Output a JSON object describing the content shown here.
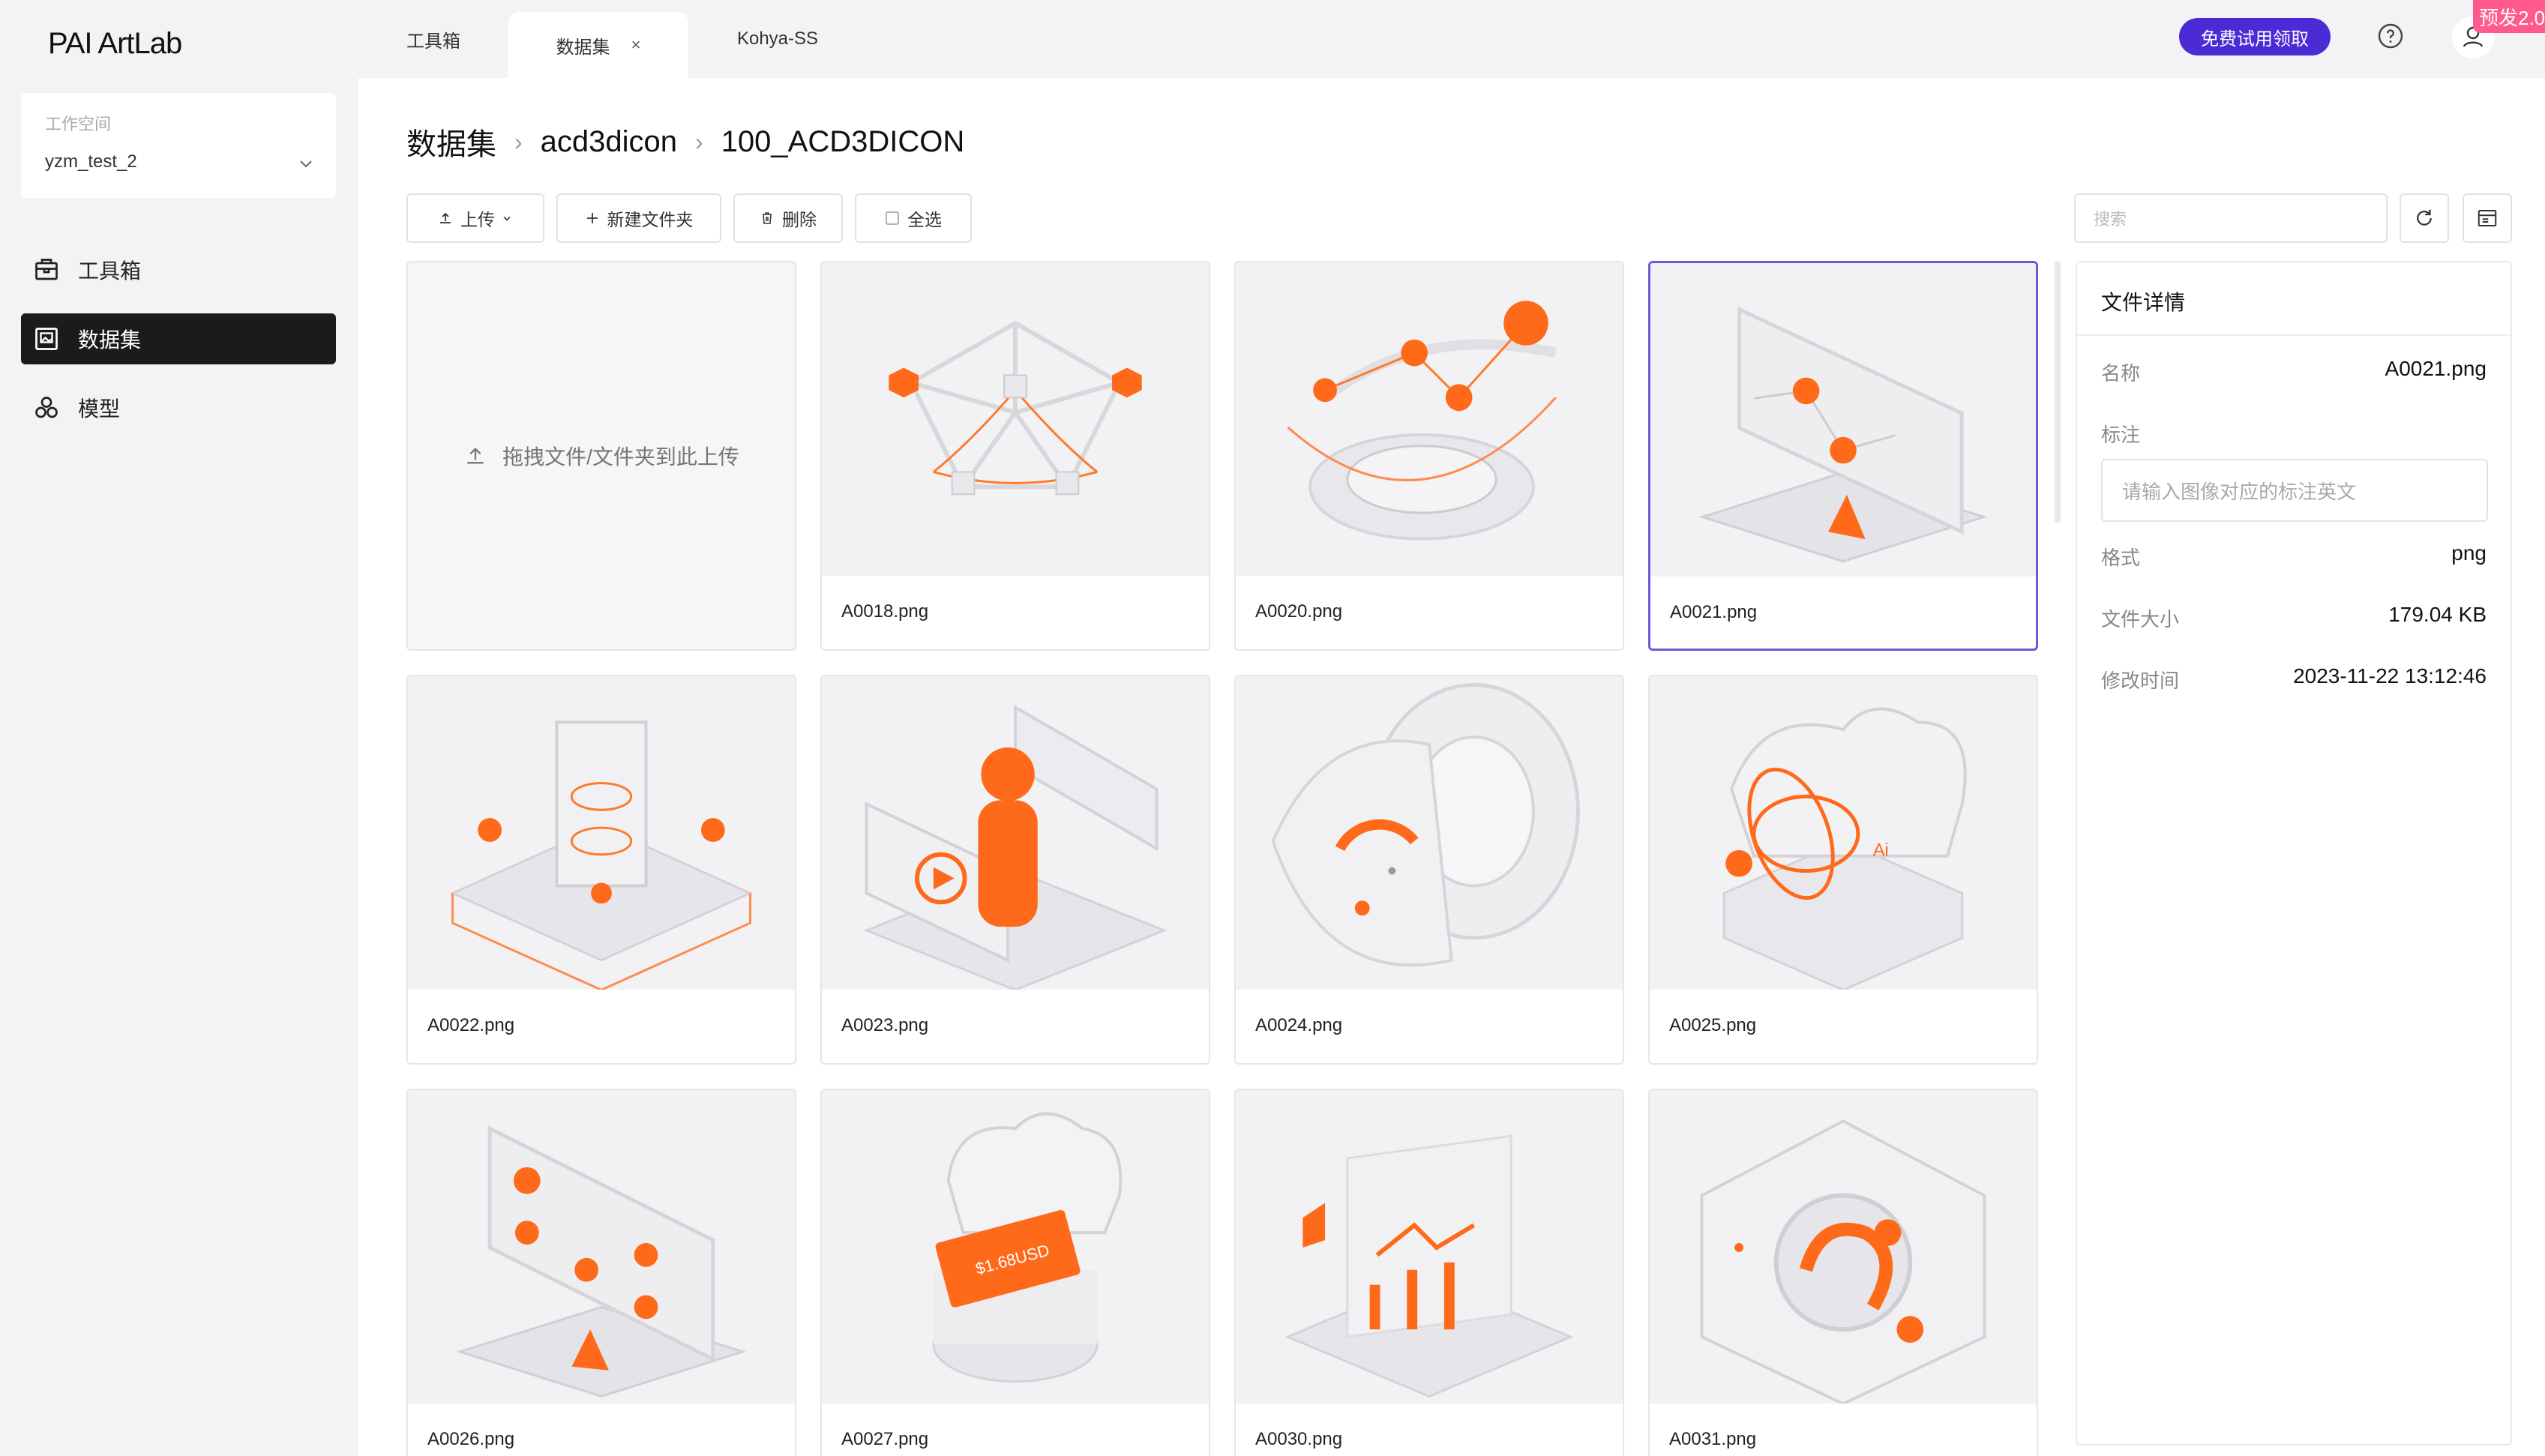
{
  "brand": {
    "logo": "PAI ArtLab"
  },
  "workspace": {
    "label": "工作空间",
    "value": "yzm_test_2"
  },
  "sidebar": {
    "items": [
      {
        "label": "工具箱",
        "icon": "toolbox-icon"
      },
      {
        "label": "数据集",
        "icon": "image-dataset-icon",
        "active": true
      },
      {
        "label": "模型",
        "icon": "model-icon"
      }
    ]
  },
  "tabs": [
    {
      "label": "工具箱"
    },
    {
      "label": "数据集",
      "active": true,
      "close": "×"
    },
    {
      "label": "Kohya-SS"
    }
  ],
  "header": {
    "trial_button": "免费试用领取",
    "badge": "预发2.0"
  },
  "breadcrumb": [
    "数据集",
    "acd3dicon",
    "100_ACD3DICON"
  ],
  "toolbar": {
    "upload": "上传",
    "new_folder": "新建文件夹",
    "delete": "删除",
    "select_all": "全选",
    "search_placeholder": "搜索"
  },
  "upload_area": {
    "text": "拖拽文件/文件夹到此上传"
  },
  "files": [
    {
      "name": "A0018.png"
    },
    {
      "name": "A0020.png"
    },
    {
      "name": "A0021.png",
      "selected": true
    },
    {
      "name": "A0022.png"
    },
    {
      "name": "A0023.png"
    },
    {
      "name": "A0024.png"
    },
    {
      "name": "A0025.png"
    },
    {
      "name": "A0026.png"
    },
    {
      "name": "A0027.png"
    },
    {
      "name": "A0030.png"
    },
    {
      "name": "A0031.png"
    }
  ],
  "details": {
    "title": "文件详情",
    "name_label": "名称",
    "name_value": "A0021.png",
    "note_label": "标注",
    "note_placeholder": "请输入图像对应的标注英文",
    "format_label": "格式",
    "format_value": "png",
    "size_label": "文件大小",
    "size_value": "179.04 KB",
    "modified_label": "修改时间",
    "modified_value": "2023-11-22 13:12:46"
  },
  "colors": {
    "accent": "#4a2bd6",
    "selected_border": "#6e5ad8",
    "illustration_orange": "#ff6a1a",
    "badge": "#ff5a8c"
  }
}
